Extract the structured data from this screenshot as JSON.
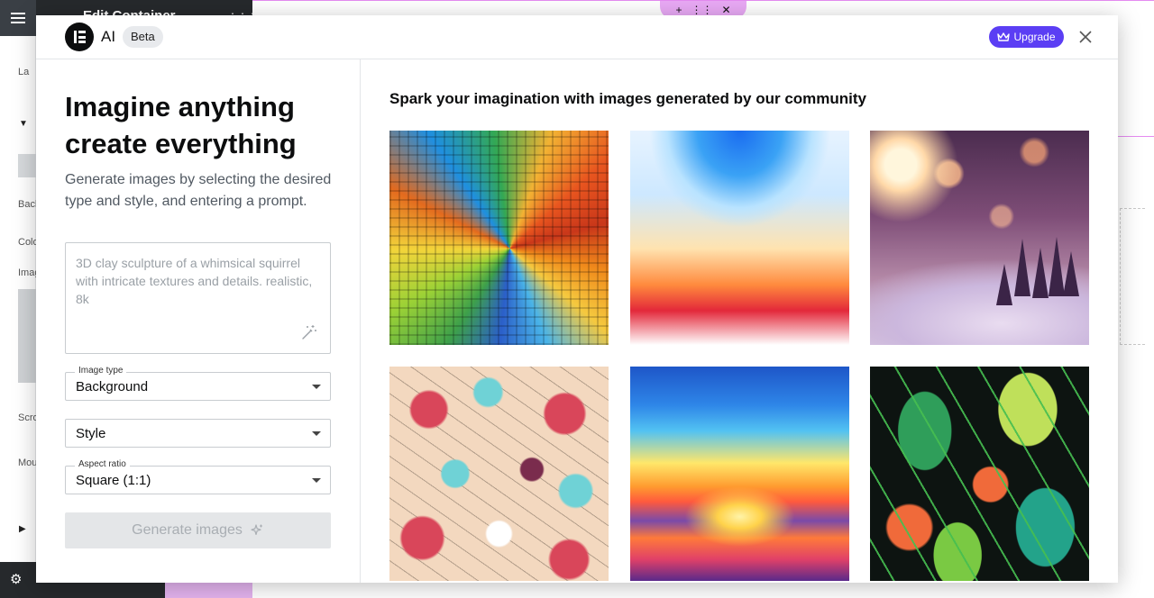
{
  "editor": {
    "title": "Edit Container",
    "panel_labels": [
      "La",
      "Back",
      "Colo",
      "Imag",
      "Scro",
      "Mou"
    ],
    "section_markers": [
      "E",
      "E"
    ]
  },
  "modal": {
    "app_name": "AI",
    "beta_label": "Beta",
    "upgrade_label": "Upgrade",
    "headline": "Imagine anything create everything",
    "subtext": "Generate images by selecting the desired type and style, and entering a prompt.",
    "prompt": {
      "placeholder": "3D clay sculpture of a whimsical squirrel with intricate textures and details. realistic, 8k",
      "value": ""
    },
    "image_type": {
      "label": "Image type",
      "value": "Background"
    },
    "style": {
      "value": "Style"
    },
    "aspect_ratio": {
      "label": "Aspect ratio",
      "value": "Square (1:1)"
    },
    "generate_label": "Generate images",
    "gallery": {
      "title": "Spark your imagination with images generated by our community",
      "images": [
        {
          "subject": "colorful mosaic tiles"
        },
        {
          "subject": "blue and orange abstract wave"
        },
        {
          "subject": "winter bokeh pine trees"
        },
        {
          "subject": "floral pattern on beige"
        },
        {
          "subject": "sunset over sea"
        },
        {
          "subject": "tropical leaves pattern"
        }
      ]
    }
  },
  "colors": {
    "accent": "#5b3ef4",
    "editor_dark": "#26292c",
    "canvas_pink": "#e58bf1"
  }
}
